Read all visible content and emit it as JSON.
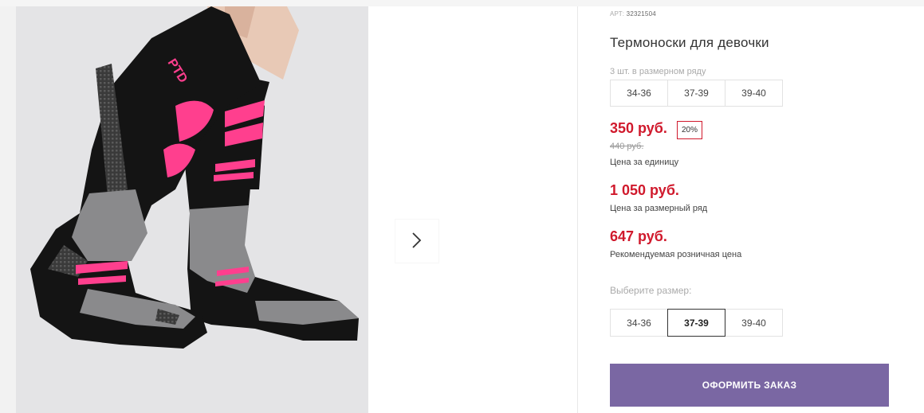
{
  "gallery": {
    "image_alt": "Термоноски для девочки",
    "sock_print": "PTD",
    "next_icon": "chevron-right-icon"
  },
  "product": {
    "art_label": "АРТ:",
    "art_number": "32321504",
    "title": "Термоноски для девочки",
    "pack_label": "3 шт. в размерном ряду",
    "pack_sizes": [
      "34-36",
      "37-39",
      "39-40"
    ]
  },
  "pricing": {
    "unit_price": "350 руб.",
    "discount": "20%",
    "old_price": "440 руб.",
    "unit_caption": "Цена за единицу",
    "row_price": "1 050 руб.",
    "row_caption": "Цена за размерный ряд",
    "rrp_price": "647 руб.",
    "rrp_caption": "Рекомендуемая розничная цена"
  },
  "size_select": {
    "label": "Выберите размер:",
    "options": [
      "34-36",
      "37-39",
      "39-40"
    ],
    "selected": "37-39"
  },
  "actions": {
    "order_label": "ОФОРМИТЬ ЗАКАЗ"
  },
  "colors": {
    "accent_red": "#d0192c",
    "button_purple": "#7a67a3",
    "sock_pink": "#ff3f8e",
    "sock_black": "#141414",
    "sock_grey": "#8a8a8c"
  }
}
